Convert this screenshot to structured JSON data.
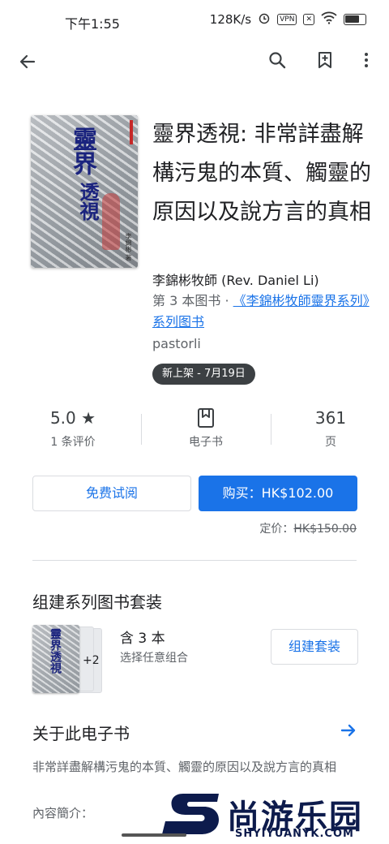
{
  "status_bar": {
    "time": "下午1:55",
    "net_speed": "128K/s",
    "vpn": "VPN",
    "battery": "57"
  },
  "app_bar": {
    "icons": [
      "back-arrow-icon",
      "search-icon",
      "bookmark-add-icon",
      "more-vert-icon"
    ]
  },
  "book": {
    "title": "靈界透視: 非常詳盡解構污鬼的本質、觸靈的原因以及說方言的真相",
    "cover_title_1": "靈界",
    "cover_title_2": "透視",
    "cover_author": "李錦彬 著",
    "author": "李錦彬牧師 (Rev. Daniel Li)",
    "series_prefix": "第 3 本图书 · ",
    "series_link": "《李錦彬牧師靈界系列》系列图书",
    "publisher": "pastorli",
    "badge": "新上架 - 7月19日"
  },
  "stats": {
    "rating": "5.0",
    "rating_label": "1 条评价",
    "format_label": "电子书",
    "pages": "361",
    "pages_label": "页"
  },
  "actions": {
    "free_sample": "免费试阅",
    "buy": "购买：HK$102.00",
    "list_price_label": "定价：",
    "list_price": "HK$150.00"
  },
  "bundle": {
    "title": "组建系列图书套装",
    "cover_title": "靈界透視",
    "more_count": "+2",
    "count_text": "含 3 本",
    "sub_text": "选择任意组合",
    "button": "组建套装"
  },
  "about": {
    "title": "关于此电子书",
    "description": "非常詳盡解構污鬼的本質、觸靈的原因以及說方言的真相",
    "intro_label": "內容簡介："
  },
  "watermark": {
    "brand": "尚游乐园",
    "url": "SHYIYUANYK.COM"
  },
  "colors": {
    "accent": "#1a73e8",
    "text_primary": "#202124",
    "text_secondary": "#5f6368",
    "badge_bg": "#3c4043"
  }
}
